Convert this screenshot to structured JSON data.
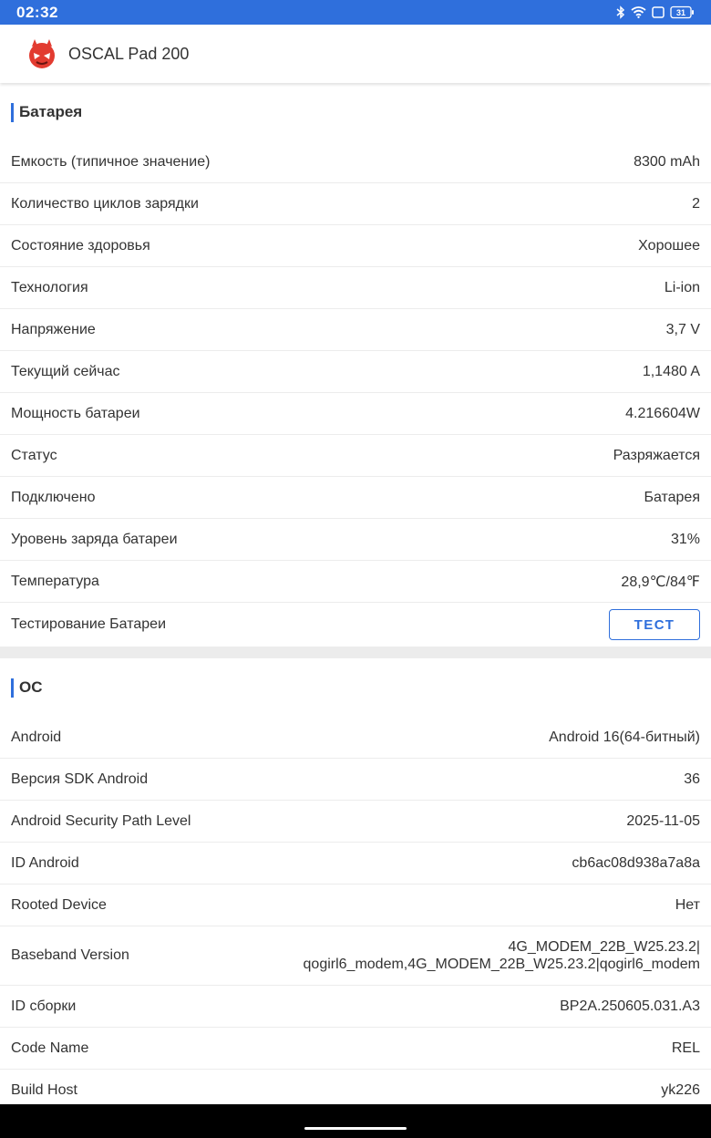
{
  "status_bar": {
    "time": "02:32",
    "battery_level": "31",
    "icons": [
      "bluetooth-icon",
      "wifi-icon",
      "screen-icon",
      "battery-icon"
    ]
  },
  "app_bar": {
    "title": "OSCAL Pad 200",
    "logo": "antutu-logo"
  },
  "battery_section": {
    "title": "Батарея",
    "rows": [
      {
        "label": "Емкость (типичное значение)",
        "value": "8300 mAh"
      },
      {
        "label": "Количество циклов зарядки",
        "value": "2"
      },
      {
        "label": "Состояние здоровья",
        "value": "Хорошее"
      },
      {
        "label": "Технология",
        "value": "Li-ion"
      },
      {
        "label": "Напряжение",
        "value": "3,7 V"
      },
      {
        "label": "Текущий сейчас",
        "value": "1,1480 A"
      },
      {
        "label": "Мощность батареи",
        "value": "4.216604W"
      },
      {
        "label": "Статус",
        "value": "Разряжается"
      },
      {
        "label": "Подключено",
        "value": "Батарея"
      },
      {
        "label": "Уровень заряда батареи",
        "value": "31%"
      },
      {
        "label": "Температура",
        "value": "28,9℃/84℉"
      }
    ],
    "test_row": {
      "label": "Тестирование Батареи",
      "button_label": "ТЕСТ"
    }
  },
  "os_section": {
    "title": "ОС",
    "rows": [
      {
        "label": "Android",
        "value": "Android 16(64-битный)"
      },
      {
        "label": "Версия SDK Android",
        "value": "36"
      },
      {
        "label": "Android Security Path Level",
        "value": "2025-11-05"
      },
      {
        "label": "ID Android",
        "value": "cb6ac08d938a7a8a"
      },
      {
        "label": "Rooted Device",
        "value": "Нет"
      },
      {
        "label": "Baseband Version",
        "value_line1": "4G_MODEM_22B_W25.23.2|",
        "value_line2": "qogirl6_modem,4G_MODEM_22B_W25.23.2|qogirl6_modem"
      },
      {
        "label": "ID сборки",
        "value": "BP2A.250605.031.A3"
      },
      {
        "label": "Code Name",
        "value": "REL"
      },
      {
        "label": "Build Host",
        "value": "yk226"
      }
    ]
  },
  "colors": {
    "accent": "#2f6fdc",
    "divider": "#ececec",
    "text": "#333333"
  }
}
